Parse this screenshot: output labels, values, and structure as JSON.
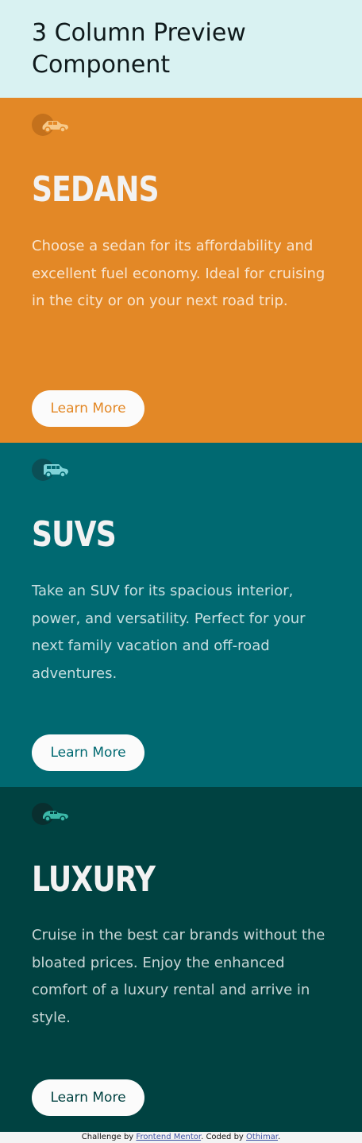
{
  "page_title": "3 Column Preview Component",
  "cards": [
    {
      "title": "SEDANS",
      "text": "Choose a sedan for its affordability and excellent fuel economy. Ideal for cruising in the city or on your next road trip.",
      "button": "Learn More",
      "icon": "sedan-car-icon",
      "color": "#e38826"
    },
    {
      "title": "SUVS",
      "text": "Take an SUV for its spacious interior, power, and versatility. Perfect for your next family vacation and off-road adventures.",
      "button": "Learn More",
      "icon": "suv-car-icon",
      "color": "#006971"
    },
    {
      "title": "LUXURY",
      "text": "Cruise in the best car brands without the bloated prices. Enjoy the enhanced comfort of a luxury rental and arrive in style.",
      "button": "Learn More",
      "icon": "luxury-car-icon",
      "color": "#004241"
    }
  ],
  "attribution": {
    "prefix": "Challenge by",
    "link1": "Frontend Mentor",
    "middle": ". Coded by",
    "link2": "Othimar",
    "suffix": "."
  }
}
